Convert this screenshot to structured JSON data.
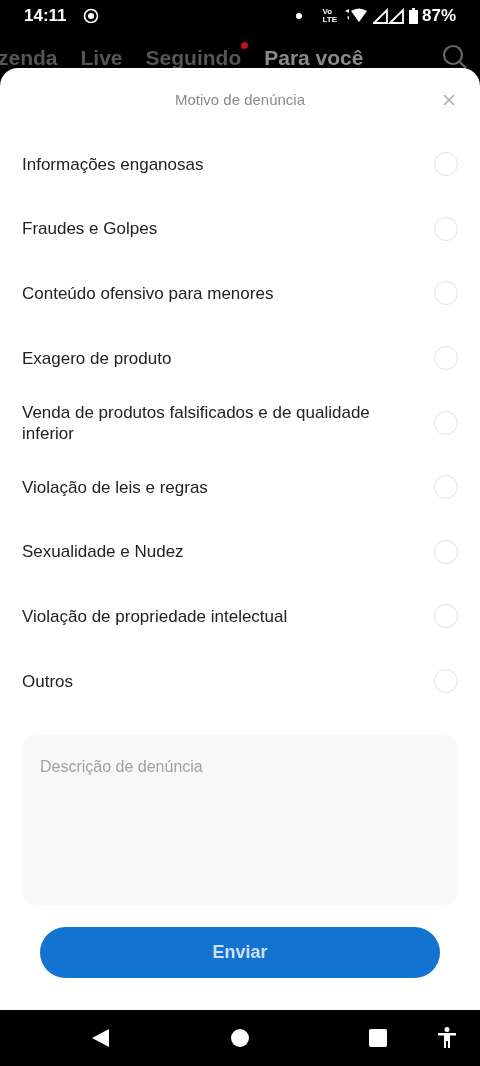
{
  "status_bar": {
    "time": "14:11",
    "volte": [
      "Vo",
      "LTE"
    ],
    "battery": "87%"
  },
  "feed_tabs": [
    {
      "label": "zenda",
      "selected": false,
      "dot": false
    },
    {
      "label": "Live",
      "selected": false,
      "dot": false
    },
    {
      "label": "Seguindo",
      "selected": false,
      "dot": true
    },
    {
      "label": "Para você",
      "selected": true,
      "dot": false
    }
  ],
  "sheet": {
    "title": "Motivo de denúncia",
    "reasons": [
      {
        "label": "Informações enganosas",
        "selected": false
      },
      {
        "label": "Fraudes e Golpes",
        "selected": false
      },
      {
        "label": "Conteúdo ofensivo para menores",
        "selected": false
      },
      {
        "label": "Exagero de produto",
        "selected": false
      },
      {
        "label": "Venda de produtos falsificados e de qualidade inferior",
        "selected": false
      },
      {
        "label": "Violação de leis e regras",
        "selected": false
      },
      {
        "label": "Sexualidade e Nudez",
        "selected": false
      },
      {
        "label": "Violação de propriedade intelectual",
        "selected": false
      },
      {
        "label": "Outros",
        "selected": false
      }
    ],
    "description": {
      "placeholder": "Descrição de denúncia"
    },
    "submit": "Enviar"
  }
}
